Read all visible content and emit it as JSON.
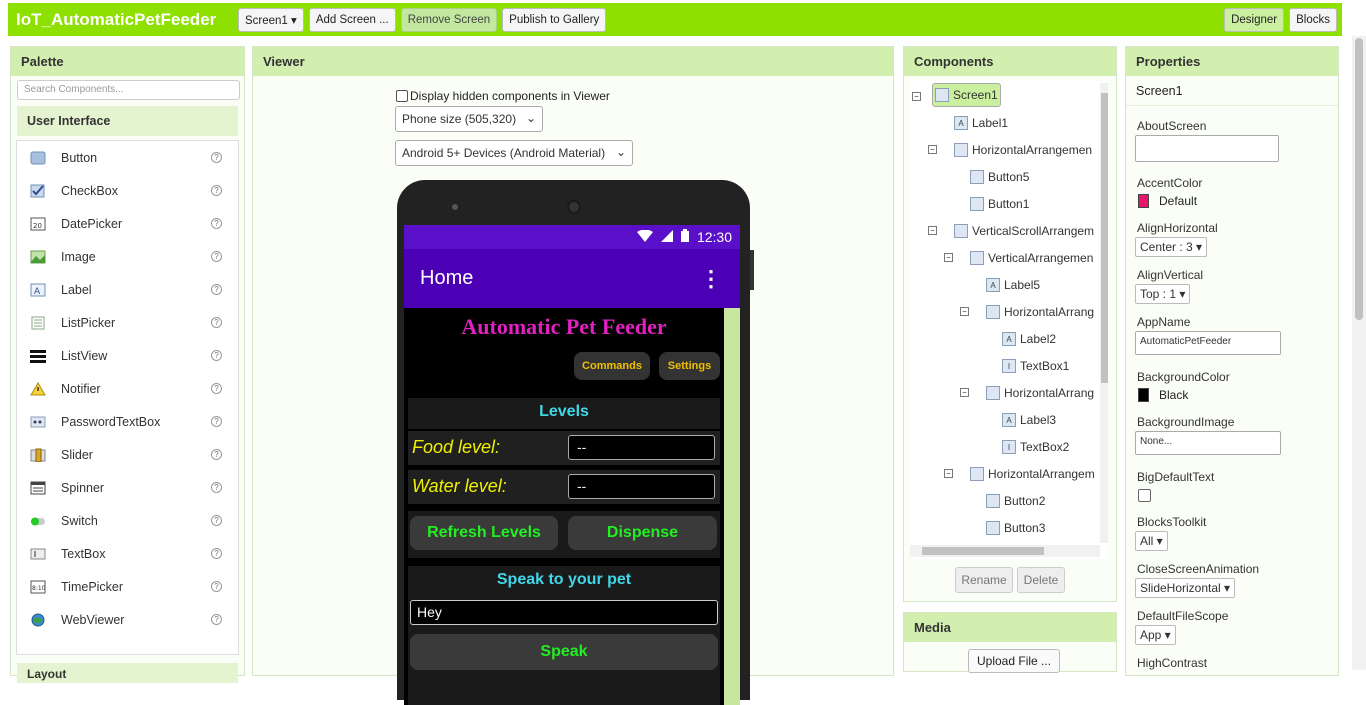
{
  "topbar": {
    "app_title": "IoT_AutomaticPetFeeder",
    "screen_dropdown": "Screen1 ▾",
    "add_screen": "Add Screen ...",
    "remove_screen": "Remove Screen",
    "publish": "Publish to Gallery",
    "designer": "Designer",
    "blocks": "Blocks"
  },
  "palette": {
    "title": "Palette",
    "search_placeholder": "Search Components...",
    "category": "User Interface",
    "items": [
      {
        "label": "Button",
        "icon": "button-icon"
      },
      {
        "label": "CheckBox",
        "icon": "checkbox-icon"
      },
      {
        "label": "DatePicker",
        "icon": "datepicker-icon"
      },
      {
        "label": "Image",
        "icon": "image-icon"
      },
      {
        "label": "Label",
        "icon": "label-icon"
      },
      {
        "label": "ListPicker",
        "icon": "listpicker-icon"
      },
      {
        "label": "ListView",
        "icon": "listview-icon"
      },
      {
        "label": "Notifier",
        "icon": "notifier-icon"
      },
      {
        "label": "PasswordTextBox",
        "icon": "password-icon"
      },
      {
        "label": "Slider",
        "icon": "slider-icon"
      },
      {
        "label": "Spinner",
        "icon": "spinner-icon"
      },
      {
        "label": "Switch",
        "icon": "switch-icon"
      },
      {
        "label": "TextBox",
        "icon": "textbox-icon"
      },
      {
        "label": "TimePicker",
        "icon": "timepicker-icon"
      },
      {
        "label": "WebViewer",
        "icon": "webviewer-icon"
      }
    ],
    "help_glyph": "?",
    "next_category": "Layout"
  },
  "viewer": {
    "title": "Viewer",
    "display_hidden": "Display hidden components in Viewer",
    "phone_size": "Phone size (505,320)",
    "device_theme": "Android 5+ Devices (Android Material)"
  },
  "phone": {
    "time": "12:30",
    "app_bar_title": "Home",
    "more_glyph": "⋮",
    "page_title": "Automatic Pet Feeder",
    "commands_btn": "Commands",
    "settings_btn": "Settings",
    "levels_header": "Levels",
    "food_label": "Food level:",
    "food_value": "--",
    "water_label": "Water level:",
    "water_value": "--",
    "refresh_btn": "Refresh Levels",
    "dispense_btn": "Dispense",
    "speak_header": "Speak to your pet",
    "speak_text": "Hey",
    "speak_btn": "Speak"
  },
  "components": {
    "title": "Components",
    "tree": [
      {
        "label": "Screen1"
      },
      {
        "label": "Label1"
      },
      {
        "label": "HorizontalArrangemen"
      },
      {
        "label": "Button5"
      },
      {
        "label": "Button1"
      },
      {
        "label": "VerticalScrollArrangem"
      },
      {
        "label": "VerticalArrangemen"
      },
      {
        "label": "Label5"
      },
      {
        "label": "HorizontalArrang"
      },
      {
        "label": "Label2"
      },
      {
        "label": "TextBox1"
      },
      {
        "label": "HorizontalArrang"
      },
      {
        "label": "Label3"
      },
      {
        "label": "TextBox2"
      },
      {
        "label": "HorizontalArrangem"
      },
      {
        "label": "Button2"
      },
      {
        "label": "Button3"
      }
    ],
    "rename": "Rename",
    "delete": "Delete"
  },
  "media": {
    "title": "Media",
    "upload": "Upload File ..."
  },
  "properties": {
    "title": "Properties",
    "component": "Screen1",
    "about_label": "AboutScreen",
    "accent_label": "AccentColor",
    "accent_value": "Default",
    "accent_color": "#e8156b",
    "align_h_label": "AlignHorizontal",
    "align_h_value": "Center : 3 ▾",
    "align_v_label": "AlignVertical",
    "align_v_value": "Top : 1 ▾",
    "appname_label": "AppName",
    "appname_value": "AutomaticPetFeeder",
    "bgcolor_label": "BackgroundColor",
    "bgcolor_value": "Black",
    "bgcolor_color": "#000000",
    "bgimage_label": "BackgroundImage",
    "bgimage_value": "None...",
    "bigtext_label": "BigDefaultText",
    "toolkit_label": "BlocksToolkit",
    "toolkit_value": "All ▾",
    "closeanim_label": "CloseScreenAnimation",
    "closeanim_value": "SlideHorizontal ▾",
    "filescope_label": "DefaultFileScope",
    "filescope_value": "App ▾",
    "highcontrast_label": "HighContrast"
  }
}
